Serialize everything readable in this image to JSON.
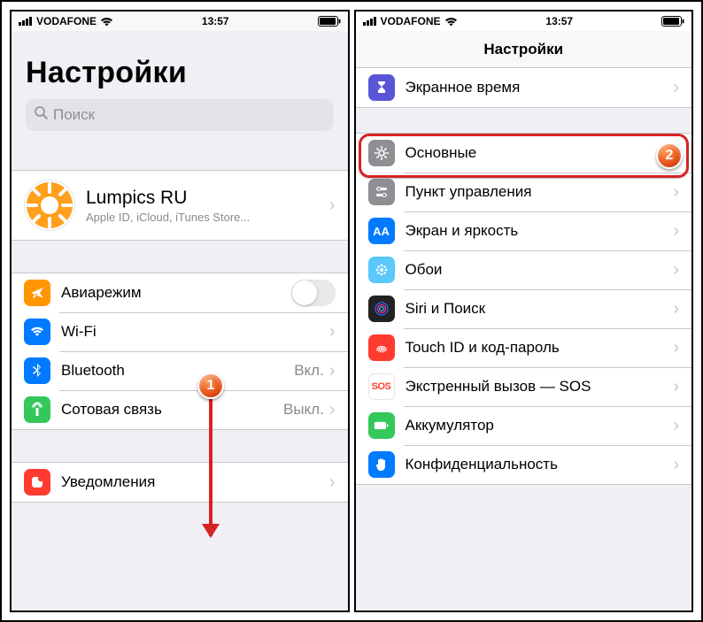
{
  "statusbar": {
    "carrier": "VODAFONE",
    "time": "13:57"
  },
  "left": {
    "title": "Настройки",
    "search_placeholder": "Поиск",
    "profile": {
      "name": "Lumpics RU",
      "sub": "Apple ID, iCloud, iTunes Store..."
    },
    "rows": {
      "airplane": "Авиарежим",
      "wifi": "Wi-Fi",
      "wifi_value": "",
      "bluetooth": "Bluetooth",
      "bluetooth_value": "Вкл.",
      "cellular": "Сотовая связь",
      "cellular_value": "Выкл.",
      "notifications": "Уведомления"
    }
  },
  "right": {
    "nav_title": "Настройки",
    "rows": {
      "screentime": "Экранное время",
      "general": "Основные",
      "controlcenter": "Пункт управления",
      "display": "Экран и яркость",
      "wallpaper": "Обои",
      "siri": "Siri и Поиск",
      "touchid": "Touch ID и код-пароль",
      "sos": "Экстренный вызов — SOS",
      "battery": "Аккумулятор",
      "privacy": "Конфиденциальность"
    }
  },
  "annotations": {
    "badge1": "1",
    "badge2": "2"
  },
  "colors": {
    "orange": "#ff9500",
    "blue": "#007aff",
    "green": "#34c759",
    "gray": "#8e8e93",
    "darkgray": "#5b5b60",
    "lightblue": "#5ac8fa",
    "purple": "#5856d6",
    "teal": "#32ade6",
    "red": "#ff3b30",
    "pink": "#ff2d55",
    "white": "#ffffff",
    "black": "#222222"
  }
}
